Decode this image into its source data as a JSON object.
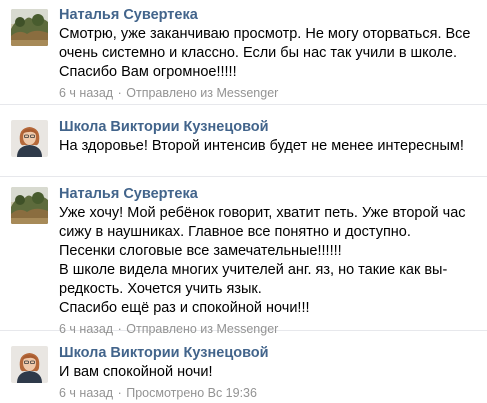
{
  "messages": [
    {
      "author": "Наталья Сувертека",
      "avatar_icon": "landscape-photo-avatar",
      "text": "Смотрю, уже заканчиваю просмотр. Не могу оторваться. Все\nочень системно и классно. Если бы нас так учили в школе.\nСпасибо Вам огромное!!!!!",
      "time": "6 ч назад",
      "status": "Отправлено из Messenger"
    },
    {
      "author": "Школа Виктории Кузнецовой",
      "avatar_icon": "woman-portrait-avatar",
      "text": "На здоровье! Второй интенсив будет не менее интересным!",
      "time": "",
      "status": ""
    },
    {
      "author": "Наталья Сувертека",
      "avatar_icon": "landscape-photo-avatar",
      "text": "Уже хочу! Мой ребёнок говорит, хватит петь. Уже второй час\nсижу в наушниках. Главное все понятно и доступно.\nПесенки слоговые все замечательные!!!!!!\nВ школе видела многих учителей анг. яз, но такие как вы-\nредкость. Хочется учить язык.\nСпасибо ещё раз и спокойной ночи!!!",
      "time": "6 ч назад",
      "status": "Отправлено из Messenger"
    },
    {
      "author": "Школа Виктории Кузнецовой",
      "avatar_icon": "woman-portrait-avatar",
      "text": "И вам спокойной ночи!",
      "time": "6 ч назад",
      "status": "Просмотрено Вс 19:36"
    }
  ],
  "meta_separator": "·",
  "colors": {
    "author": "#42648b",
    "meta": "#939393",
    "divider": "#e7e8ec"
  }
}
